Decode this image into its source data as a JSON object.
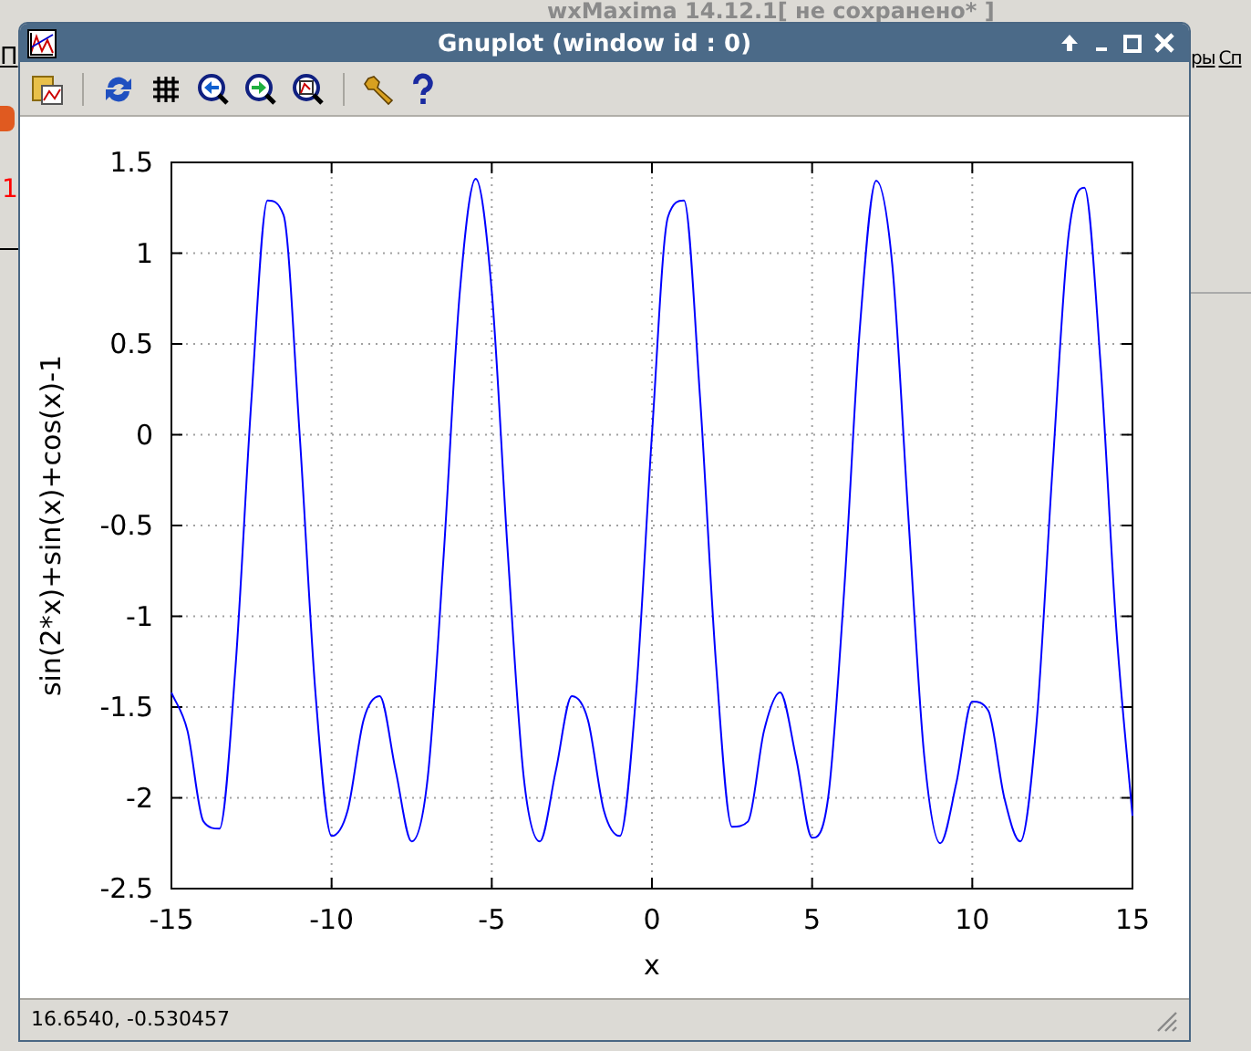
{
  "background_window": {
    "title": "wxMaxima 14.12.1[ не сохранено* ]",
    "menu_left": "П",
    "menu_right": [
      "ры",
      "Сп"
    ],
    "cell_label": "1"
  },
  "window": {
    "title": "Gnuplot (window id : 0)"
  },
  "plot": {
    "chart_data": {
      "type": "line",
      "xlabel": "x",
      "ylabel": "sin(2*x)+sin(x)+cos(x)-1",
      "x": [
        -15,
        -14.5,
        -14,
        -13.5,
        -13,
        -12.5,
        -12,
        -11.5,
        -11,
        -10.5,
        -10,
        -9.5,
        -9,
        -8.5,
        -8,
        -7.5,
        -7,
        -6.5,
        -6,
        -5.5,
        -5,
        -4.5,
        -4,
        -3.5,
        -3,
        -2.5,
        -2,
        -1.5,
        -1,
        -0.5,
        0,
        0.5,
        1,
        1.5,
        2,
        2.5,
        3,
        3.5,
        4,
        4.5,
        5,
        5.5,
        6,
        6.5,
        7,
        7.5,
        8,
        8.5,
        9,
        9.5,
        10,
        10.5,
        11,
        11.5,
        12,
        12.5,
        13,
        13.5,
        14,
        14.5,
        15
      ],
      "series": [
        {
          "color": "#0000ff",
          "values": [
            -1.42,
            -1.63,
            -2.13,
            -2.17,
            -1.28,
            0.2,
            1.29,
            1.21,
            0.01,
            -1.43,
            -2.21,
            -2.07,
            -1.57,
            -1.44,
            -1.85,
            -2.24,
            -1.89,
            -0.66,
            0.78,
            1.41,
            0.79,
            -0.65,
            -1.89,
            -2.24,
            -1.85,
            -1.44,
            -1.57,
            -2.07,
            -2.21,
            -1.44,
            0,
            1.2,
            1.29,
            0.21,
            -1.26,
            -2.16,
            -2.13,
            -1.63,
            -1.42,
            -1.78,
            -2.22,
            -2,
            -0.86,
            0.61,
            1.4,
            0.94,
            -0.44,
            -1.77,
            -2.25,
            -1.92,
            -1.47,
            -1.52,
            -2,
            -2.24,
            -1.6,
            -0.2,
            1.09,
            1.36,
            0.4,
            -1.08,
            -2.1
          ]
        }
      ],
      "grid": true,
      "xlim": [
        -15,
        15
      ],
      "ylim": [
        -2.5,
        1.5
      ],
      "xticks": [
        -15,
        -10,
        -5,
        0,
        5,
        10,
        15
      ],
      "yticks": [
        -2.5,
        -2,
        -1.5,
        -1,
        -0.5,
        0,
        0.5,
        1,
        1.5
      ]
    }
  },
  "status_bar": {
    "text": "16.6540, -0.530457"
  }
}
